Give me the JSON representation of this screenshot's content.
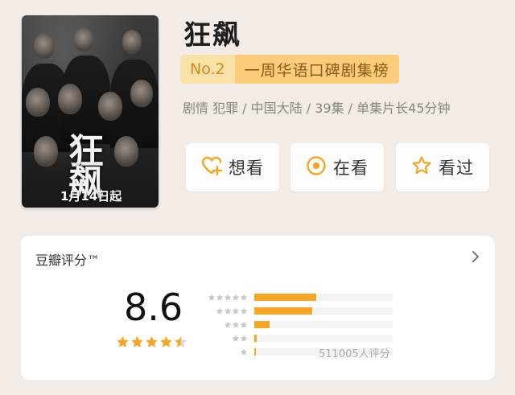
{
  "poster": {
    "title_text": "狂飙",
    "date_text": "1月14日起"
  },
  "show": {
    "title": "狂飙",
    "rank_no": "No.2",
    "rank_label": "一周华语口碑剧集榜",
    "meta": "剧情 犯罪 / 中国大陆 / 39集 / 单集片长45分钟"
  },
  "actions": [
    {
      "label": "想看",
      "icon": "heart-plus-icon"
    },
    {
      "label": "在看",
      "icon": "target-circle-icon"
    },
    {
      "label": "看过",
      "icon": "star-outline-icon"
    }
  ],
  "rating": {
    "label": "豆瓣评分™",
    "score": "8.6",
    "stars_filled": 4.5,
    "count_text": "511005人评分",
    "distribution": [
      {
        "stars": 5,
        "fraction": 0.45
      },
      {
        "stars": 4,
        "fraction": 0.42
      },
      {
        "stars": 3,
        "fraction": 0.11
      },
      {
        "stars": 2,
        "fraction": 0.015
      },
      {
        "stars": 1,
        "fraction": 0.01
      }
    ]
  },
  "colors": {
    "accent": "#f5a623",
    "rank_light": "#fae1a8",
    "rank_dark": "#fbcc7a",
    "background": "#f3ece6"
  }
}
